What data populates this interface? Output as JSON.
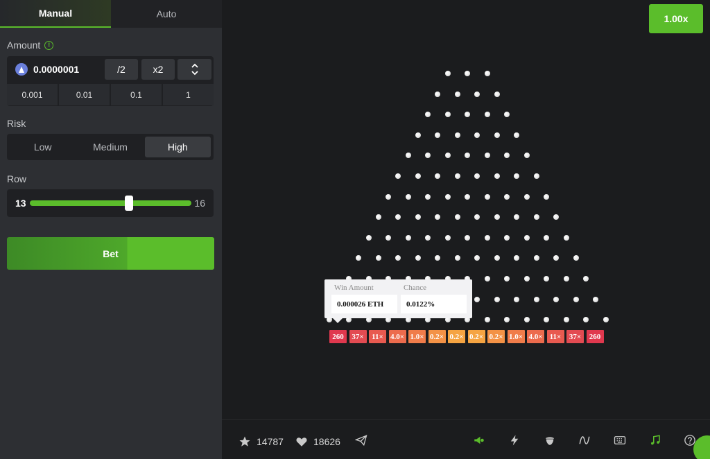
{
  "tabs": {
    "manual": "Manual",
    "auto": "Auto"
  },
  "amount": {
    "label": "Amount",
    "value": "0.0000001",
    "half": "/2",
    "double": "x2",
    "quick": [
      "0.001",
      "0.01",
      "0.1",
      "1"
    ]
  },
  "risk": {
    "label": "Risk",
    "options": [
      "Low",
      "Medium",
      "High"
    ],
    "selected": "High"
  },
  "row": {
    "label": "Row",
    "value": "13",
    "max": "16"
  },
  "bet": {
    "label": "Bet"
  },
  "multiplier_badge": "1.00x",
  "buckets": [
    "260",
    "37×",
    "11×",
    "4.0×",
    "1.0×",
    "0.2×",
    "0.2×",
    "0.2×",
    "0.2×",
    "1.0×",
    "4.0×",
    "11×",
    "37×",
    "260"
  ],
  "bucket_colors": [
    "#e0384e",
    "#e34b52",
    "#e85a50",
    "#ec6b4d",
    "#f07c4a",
    "#f39246",
    "#f5a442",
    "#f5a442",
    "#f39246",
    "#f07c4a",
    "#ec6b4d",
    "#e85a50",
    "#e34b52",
    "#e0384e"
  ],
  "tooltip": {
    "win_label": "Win Amount",
    "win_value": "0.000026 ETH",
    "chance_label": "Chance",
    "chance_value": "0.0122%"
  },
  "footer": {
    "stars": "14787",
    "likes": "18626",
    "icons": [
      "star-icon",
      "heart-icon",
      "send-icon",
      "megaphone-icon",
      "lightning-icon",
      "acorn-icon",
      "curve-icon",
      "keyboard-icon",
      "music-icon",
      "help-icon"
    ]
  },
  "colors": {
    "accent": "#5bbd2b"
  }
}
